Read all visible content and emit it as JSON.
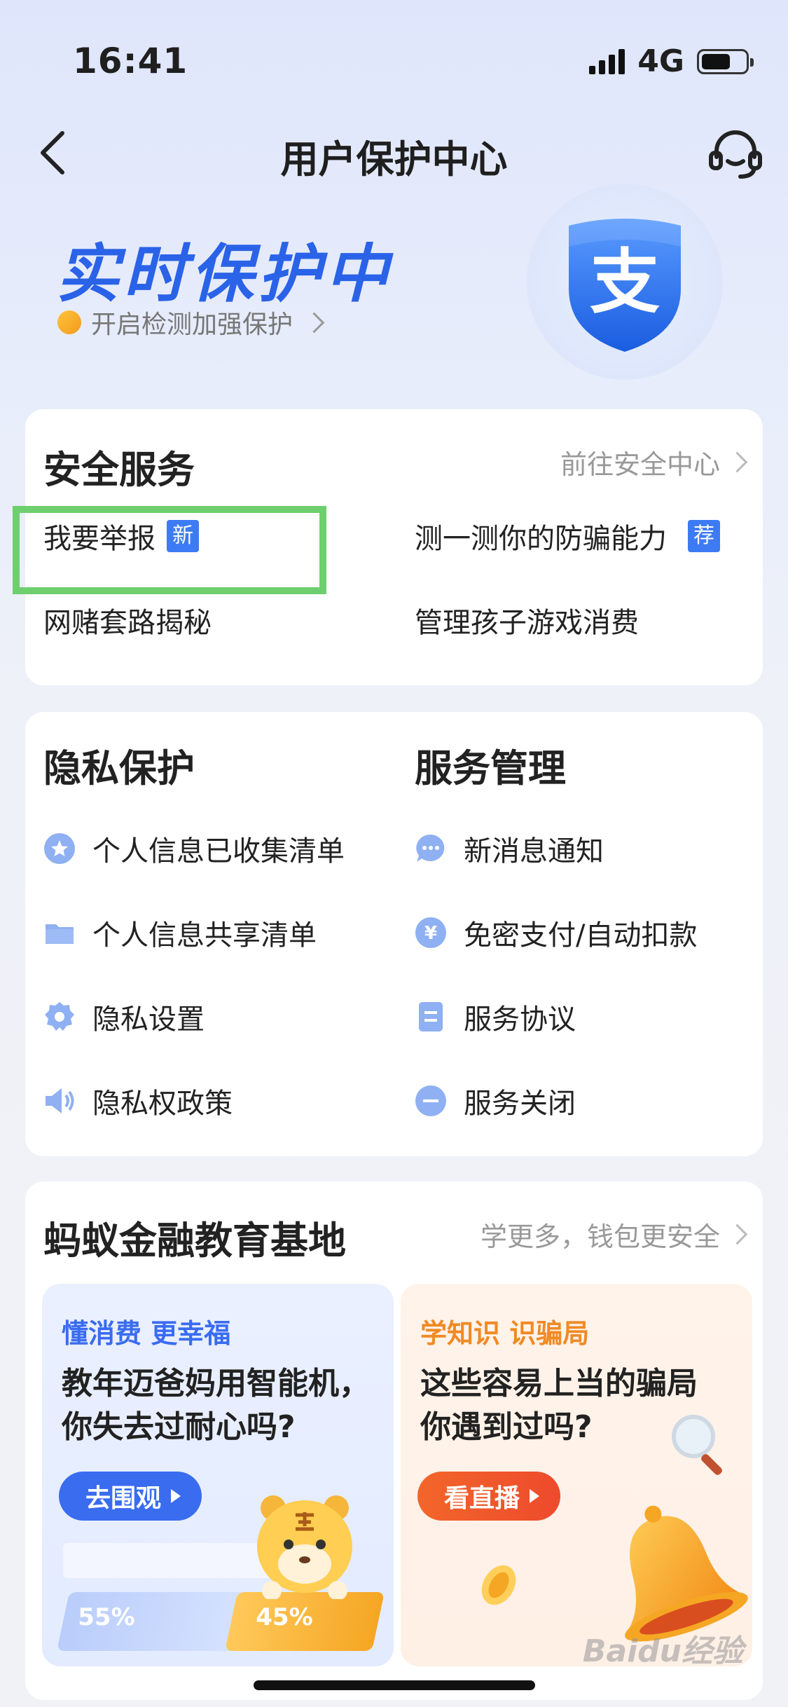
{
  "status": {
    "time": "16:41",
    "network": "4G",
    "battery_pct": 0.6
  },
  "nav": {
    "title": "用户保护中心"
  },
  "hero": {
    "title": "实时保护中",
    "subtitle": "开启检测加强保护",
    "shield_char": "支"
  },
  "security": {
    "title": "安全服务",
    "link": "前往安全中心",
    "items": [
      {
        "label": "我要举报",
        "tag": "新"
      },
      {
        "label": "测一测你的防骗能力",
        "tag": "荐"
      },
      {
        "label": "网赌套路揭秘"
      },
      {
        "label": "管理孩子游戏消费"
      }
    ]
  },
  "privacy": {
    "title": "隐私保护",
    "items": [
      "个人信息已收集清单",
      "个人信息共享清单",
      "隐私设置",
      "隐私权政策"
    ]
  },
  "service": {
    "title": "服务管理",
    "items": [
      "新消息通知",
      "免密支付/自动扣款",
      "服务协议",
      "服务关闭"
    ],
    "yen": "¥"
  },
  "edu": {
    "title": "蚂蚁金融教育基地",
    "link": "学更多，钱包更安全",
    "cards": [
      {
        "tag": "懂消费 更幸福",
        "headline": "教年迈爸妈用智能机，你失去过耐心吗?",
        "button": "去围观",
        "stat_left": "55%",
        "stat_right": "45%"
      },
      {
        "tag": "学知识 识骗局",
        "headline": "这些容易上当的骗局你遇到过吗?",
        "button": "看直播"
      }
    ]
  },
  "watermark": "Baidu经验",
  "colors": {
    "accent": "#2a63e8",
    "tag_blue": "#3d7bf5",
    "edu_blue": "#3a6cf0",
    "edu_orange": "#f08a24",
    "highlight": "#6ecf6e"
  }
}
